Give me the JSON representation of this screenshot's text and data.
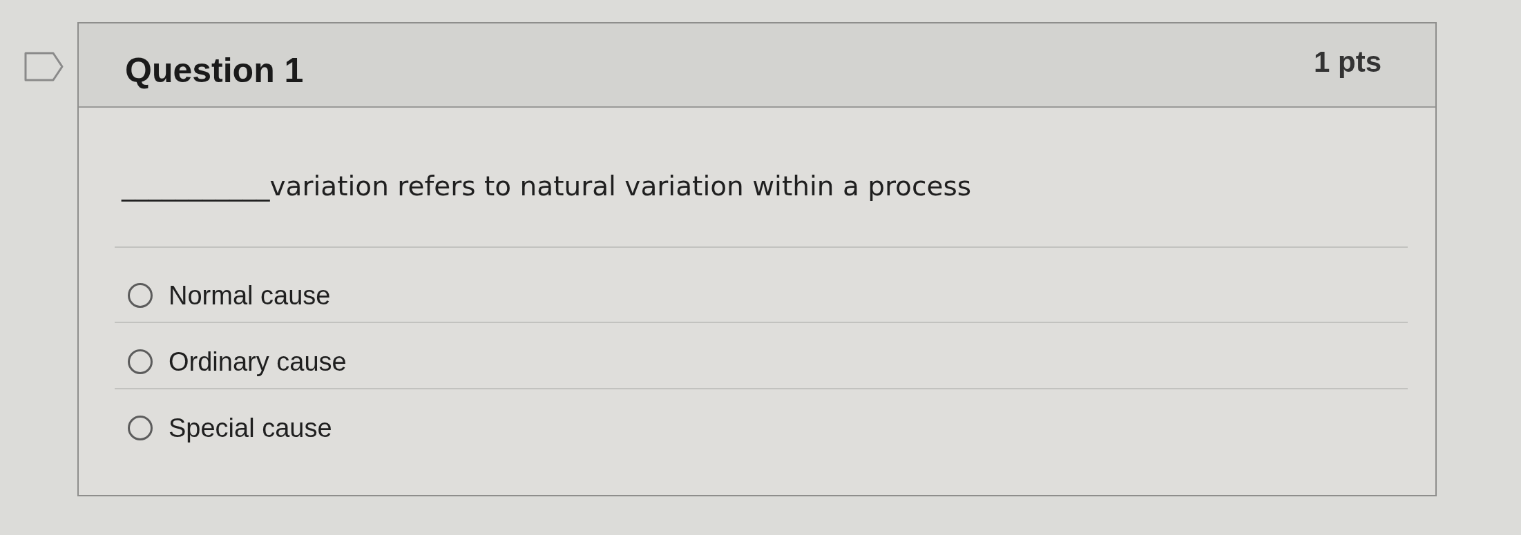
{
  "question": {
    "title": "Question 1",
    "points": "1 pts",
    "text": "___________variation refers to natural variation within a process",
    "answers": [
      {
        "label": "Normal cause",
        "selected": false
      },
      {
        "label": "Ordinary cause",
        "selected": false
      },
      {
        "label": "Special cause",
        "selected": false
      }
    ]
  }
}
